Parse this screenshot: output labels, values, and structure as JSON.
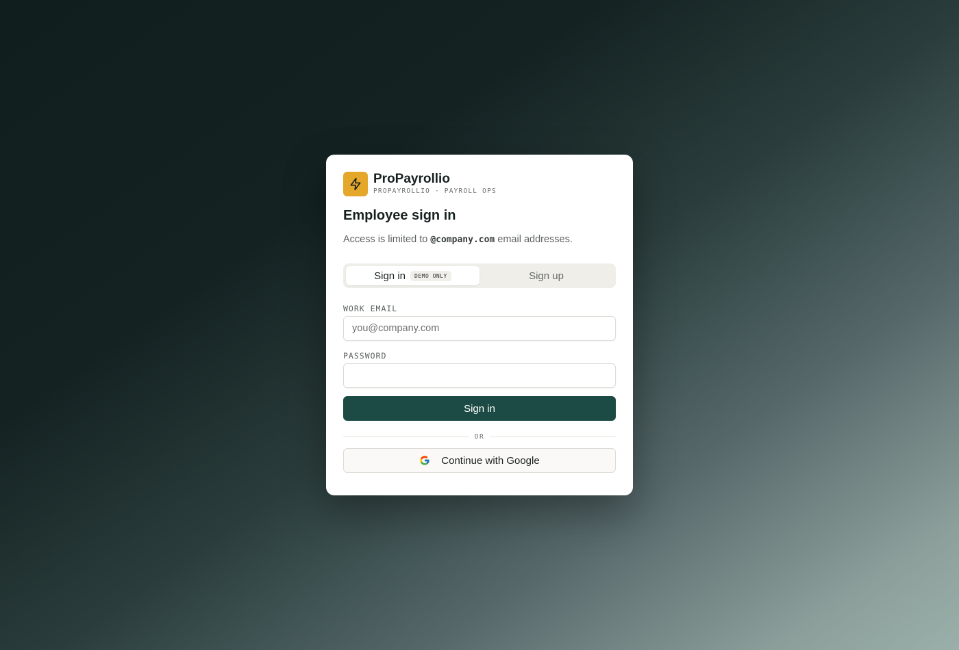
{
  "brand": {
    "name": "ProPayrollio",
    "tagline": "PROPAYROLLIO · PAYROLL OPS",
    "logo_icon": "lightning-bolt-icon",
    "logo_color": "#e5a72a"
  },
  "heading": {
    "title": "Employee sign in",
    "subtitle_prefix": "Access is limited to ",
    "subtitle_domain": "@company.com",
    "subtitle_suffix": " email addresses."
  },
  "tabs": [
    {
      "label": "Sign in",
      "badge": "DEMO ONLY",
      "active": true
    },
    {
      "label": "Sign up",
      "active": false
    }
  ],
  "form": {
    "email_label": "WORK EMAIL",
    "email_placeholder": "you@company.com",
    "email_value": "",
    "password_label": "PASSWORD",
    "password_value": "",
    "submit_label": "Sign in",
    "submit_color": "#1c4b45"
  },
  "divider": {
    "label": "OR"
  },
  "google": {
    "label": "Continue with Google",
    "icon": "google-g-icon"
  }
}
